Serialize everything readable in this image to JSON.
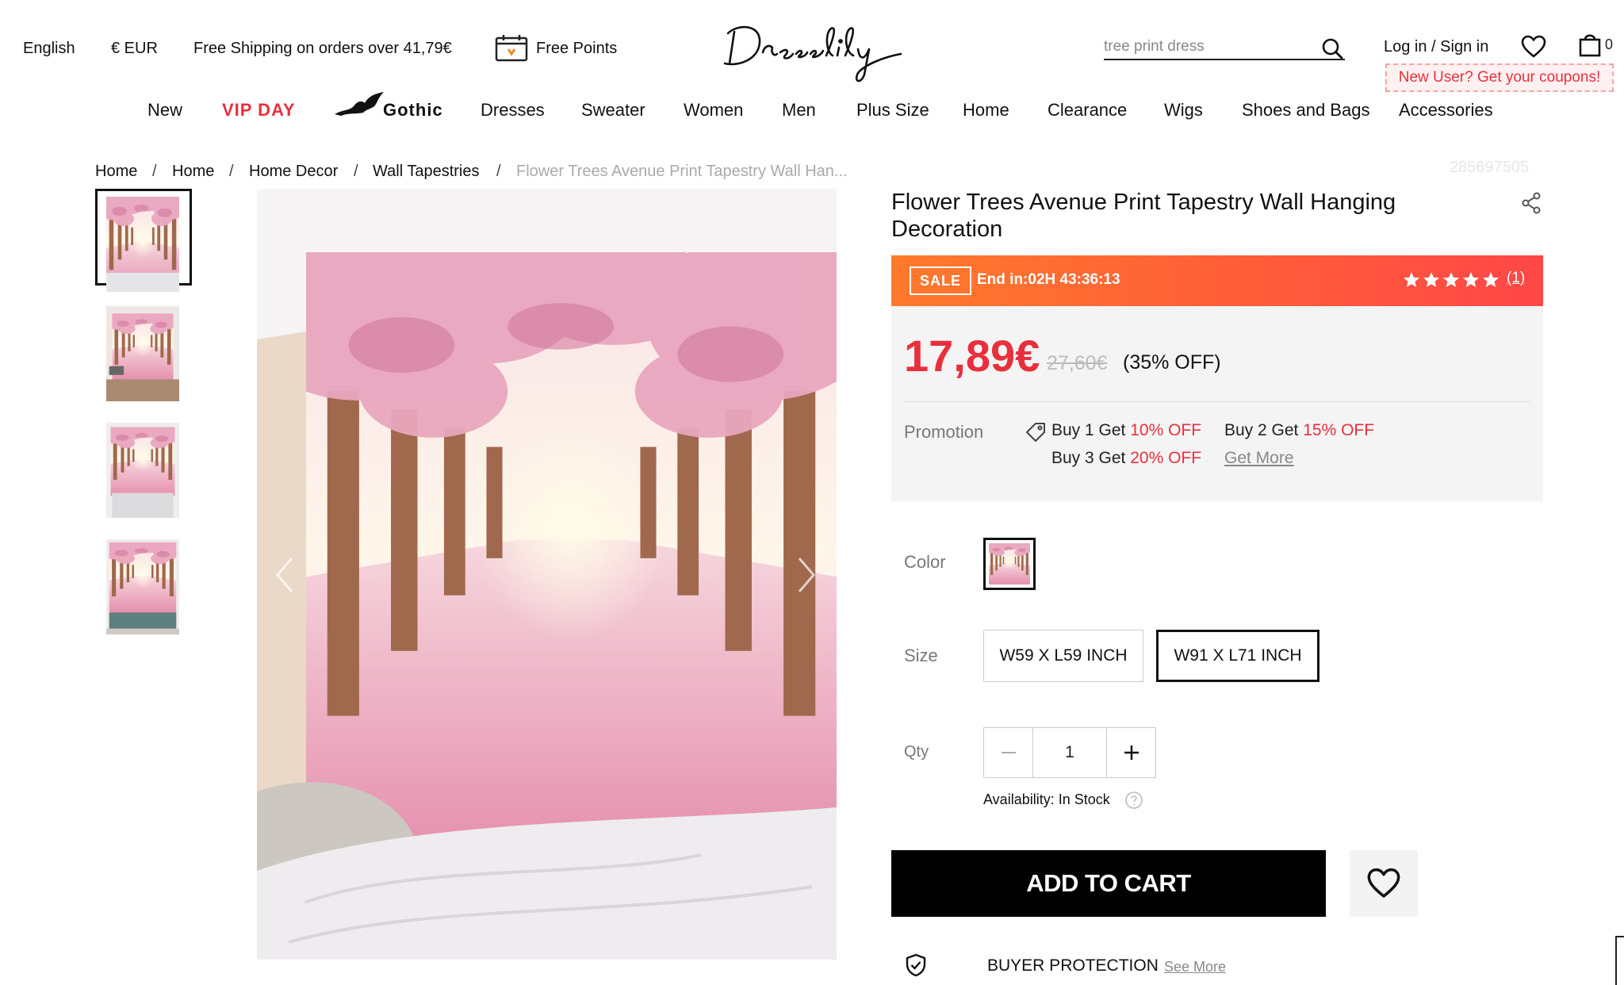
{
  "header": {
    "language": "English",
    "currency": "€ EUR",
    "shipping": "Free Shipping on orders over 41,79€",
    "free_points": "Free Points",
    "search_placeholder": "tree print dress",
    "login": "Log in / Sign in",
    "cart_count": "0",
    "coupon": "New User? Get your coupons!"
  },
  "nav": [
    "New",
    "VIP DAY",
    "Gothic",
    "Dresses",
    "Sweater",
    "Women",
    "Men",
    "Plus Size",
    "Home",
    "Clearance",
    "Wigs",
    "Shoes and Bags",
    "Accessories"
  ],
  "breadcrumb": [
    "Home",
    "Home",
    "Home Decor",
    "Wall Tapestries",
    "Flower Trees Avenue Print Tapestry Wall Han..."
  ],
  "breadcrumb_separator": "/",
  "product": {
    "sku": "285697505",
    "title": "Flower Trees Avenue Print Tapestry Wall Hanging Decoration",
    "sale_badge": "SALE",
    "sale_end": "End in:02H 43:36:13",
    "rating": 5,
    "review_count": "(1)",
    "price": "17,89€",
    "original_price": "27,60€",
    "discount": "(35% OFF)",
    "promotion_label": "Promotion",
    "promotions": [
      {
        "prefix": "Buy 1 Get ",
        "offer": "10% OFF"
      },
      {
        "prefix": "Buy 2 Get ",
        "offer": "15% OFF"
      },
      {
        "prefix": "Buy 3 Get ",
        "offer": "20% OFF"
      }
    ],
    "get_more": "Get More",
    "color_label": "Color",
    "size_label": "Size",
    "sizes": [
      "W59 X L59 INCH",
      "W91 X L71 INCH"
    ],
    "selected_size": "W91 X L71 INCH",
    "qty_label": "Qty",
    "qty": "1",
    "availability": "Availability: In Stock",
    "add_to_cart": "ADD TO CART",
    "buyer_protection": "BUYER PROTECTION",
    "see_more": "See More"
  },
  "colors": {
    "accent_red": "#e8303d",
    "sale_gradient_start": "#ff7a2c",
    "sale_gradient_end": "#ff4747"
  }
}
